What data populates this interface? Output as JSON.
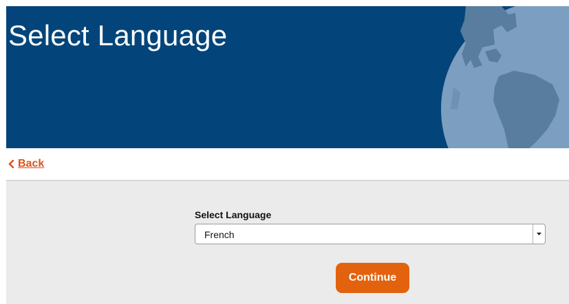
{
  "header": {
    "title": "Select Language",
    "background_color": "#03457a",
    "illustration": "globe-icon"
  },
  "nav": {
    "back_label": "Back",
    "back_icon": "chevron-left-icon",
    "link_color": "#d9531e"
  },
  "form": {
    "language_label": "Select Language",
    "language_value": "French",
    "dropdown_icon": "dropdown-arrow-icon",
    "continue_label": "Continue",
    "continue_color": "#e3620e"
  }
}
